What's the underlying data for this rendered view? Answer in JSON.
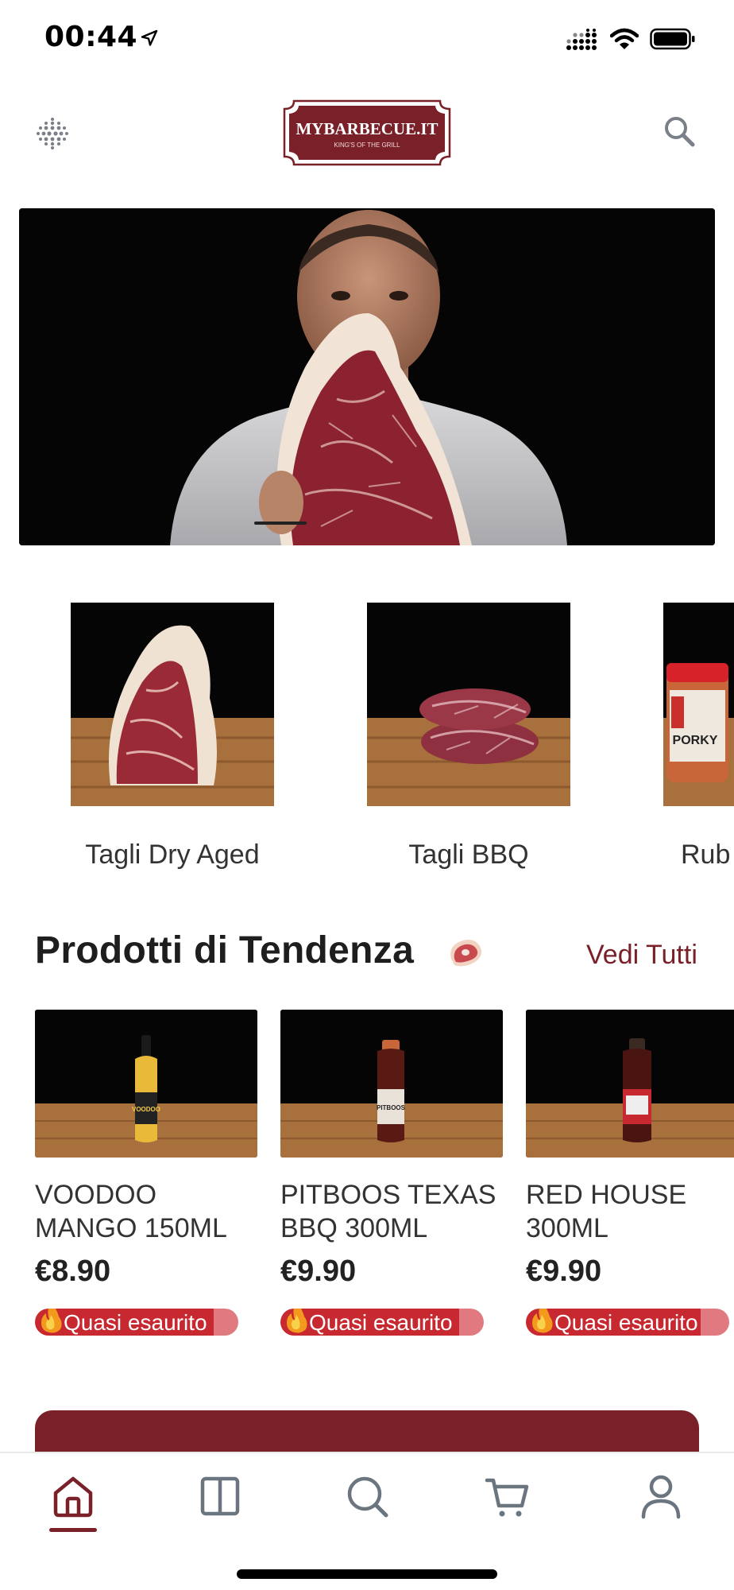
{
  "status_bar": {
    "time": "00:44"
  },
  "header": {
    "logo_text": "MYBARBECUE.IT",
    "logo_tagline": "KING'S OF THE GRILL"
  },
  "categories": [
    {
      "label": "Tagli Dry Aged"
    },
    {
      "label": "Tagli BBQ"
    },
    {
      "label": "Rub"
    }
  ],
  "trending": {
    "title": "Prodotti di Tendenza",
    "see_all": "Vedi Tutti",
    "products": [
      {
        "name": "VOODOO MANGO 150ML",
        "price": "€8.90",
        "badge": "Quasi esaurito",
        "stock_fraction": 0.88
      },
      {
        "name": "PITBOOS TEXAS BBQ 300ML",
        "price": "€9.90",
        "badge": "Quasi esaurito",
        "stock_fraction": 0.88
      },
      {
        "name": "RED HOUSE 300ML",
        "price": "€9.90",
        "badge": "Quasi esaurito",
        "stock_fraction": 0.86
      }
    ]
  },
  "tabbar": {
    "items": [
      {
        "icon": "home-icon",
        "active": true
      },
      {
        "icon": "catalog-icon",
        "active": false
      },
      {
        "icon": "search-icon",
        "active": false
      },
      {
        "icon": "cart-icon",
        "active": false
      },
      {
        "icon": "user-icon",
        "active": false
      }
    ]
  },
  "colors": {
    "brand": "#7a2028",
    "badge": "#c8282f",
    "badge_track": "#e07a80"
  }
}
